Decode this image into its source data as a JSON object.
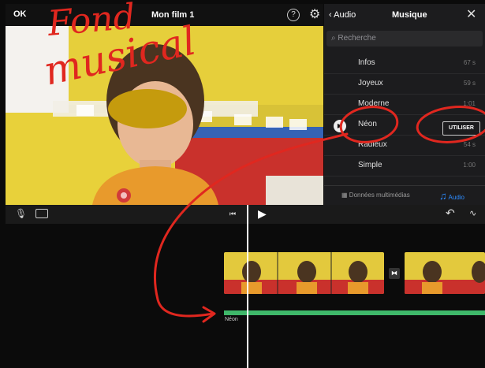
{
  "topbar": {
    "ok_label": "OK",
    "title": "Mon film 1"
  },
  "panel": {
    "back_label": "Audio",
    "title": "Musique",
    "search_placeholder": "Recherche",
    "tracks": [
      {
        "name": "Infos",
        "duration": "67 s"
      },
      {
        "name": "Joyeux",
        "duration": "59 s"
      },
      {
        "name": "Moderne",
        "duration": "1:01"
      },
      {
        "name": "Néon",
        "duration": ""
      },
      {
        "name": "Radieux",
        "duration": "54 s"
      },
      {
        "name": "Simple",
        "duration": "1:00"
      }
    ],
    "use_button": "UTILISER",
    "tab_media": "Données multimédias",
    "tab_audio": "Audio"
  },
  "timeline": {
    "audio_label": "Néon"
  },
  "annotation": {
    "line1": "Fond",
    "line2": "musical"
  },
  "colors": {
    "annotation_red": "#e0271f",
    "audio_green": "#3fb86a",
    "accent_blue": "#2d8cff"
  }
}
